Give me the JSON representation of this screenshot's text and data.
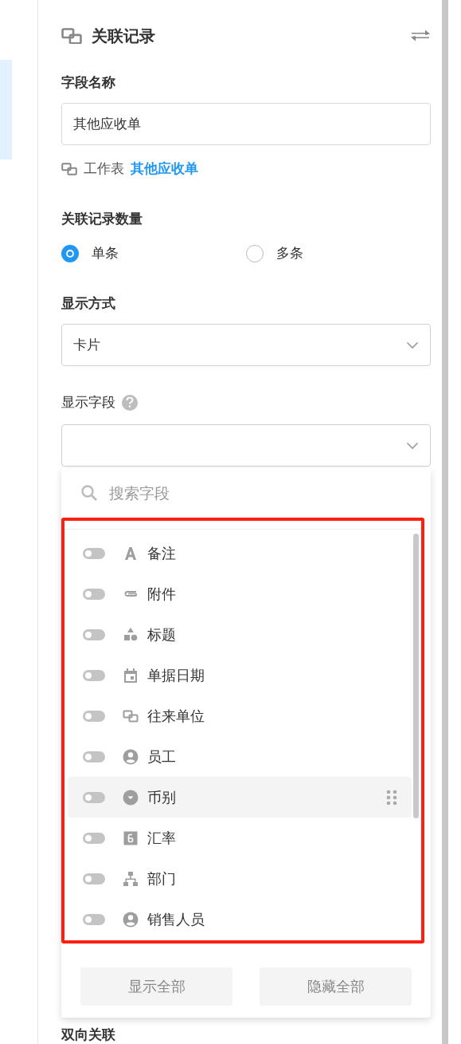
{
  "header": {
    "title": "关联记录"
  },
  "field_name": {
    "label": "字段名称",
    "value": "其他应收单"
  },
  "worksheet": {
    "label": "工作表",
    "link": "其他应收单"
  },
  "record_count": {
    "label": "关联记录数量",
    "options": [
      {
        "label": "单条",
        "selected": true
      },
      {
        "label": "多条",
        "selected": false
      }
    ]
  },
  "display_mode": {
    "label": "显示方式",
    "value": "卡片"
  },
  "display_fields": {
    "label": "显示字段",
    "search_placeholder": "搜索字段",
    "items": [
      {
        "label": "备注",
        "kind": "text",
        "on": false,
        "highlighted": false
      },
      {
        "label": "附件",
        "kind": "attachment",
        "on": false,
        "highlighted": false
      },
      {
        "label": "标题",
        "kind": "shapes",
        "on": false,
        "highlighted": false
      },
      {
        "label": "单据日期",
        "kind": "date",
        "on": false,
        "highlighted": false
      },
      {
        "label": "往来单位",
        "kind": "relation",
        "on": false,
        "highlighted": false
      },
      {
        "label": "员工",
        "kind": "user",
        "on": false,
        "highlighted": false
      },
      {
        "label": "币别",
        "kind": "dropdown",
        "on": false,
        "highlighted": true
      },
      {
        "label": "汇率",
        "kind": "number",
        "on": false,
        "highlighted": false
      },
      {
        "label": "部门",
        "kind": "department",
        "on": false,
        "highlighted": false
      },
      {
        "label": "销售人员",
        "kind": "user",
        "on": false,
        "highlighted": false
      }
    ],
    "buttons": [
      "显示全部",
      "隐藏全部"
    ]
  },
  "next_section": {
    "label": "双向关联"
  }
}
